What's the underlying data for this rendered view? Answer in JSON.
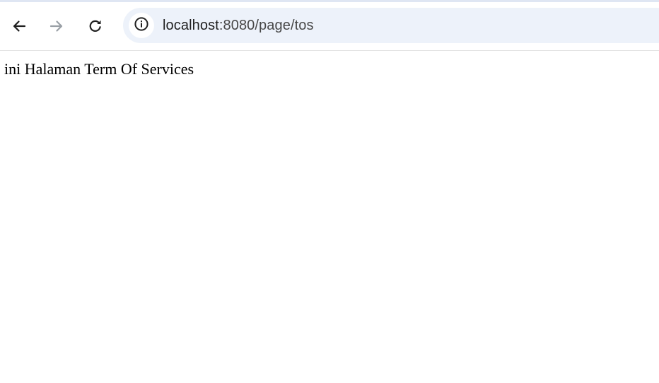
{
  "browser": {
    "address_bar": {
      "host": "localhost",
      "path": ":8080/page/tos"
    },
    "icons": {
      "back": "arrow-left-icon",
      "forward": "arrow-right-icon",
      "reload": "reload-icon",
      "site_info": "info-icon"
    }
  },
  "page": {
    "body_text": "ini Halaman Term Of Services"
  },
  "colors": {
    "omnibox_bg": "#edf2fa",
    "icon_active": "#1f1f1f",
    "icon_disabled": "#9aa0a6"
  }
}
